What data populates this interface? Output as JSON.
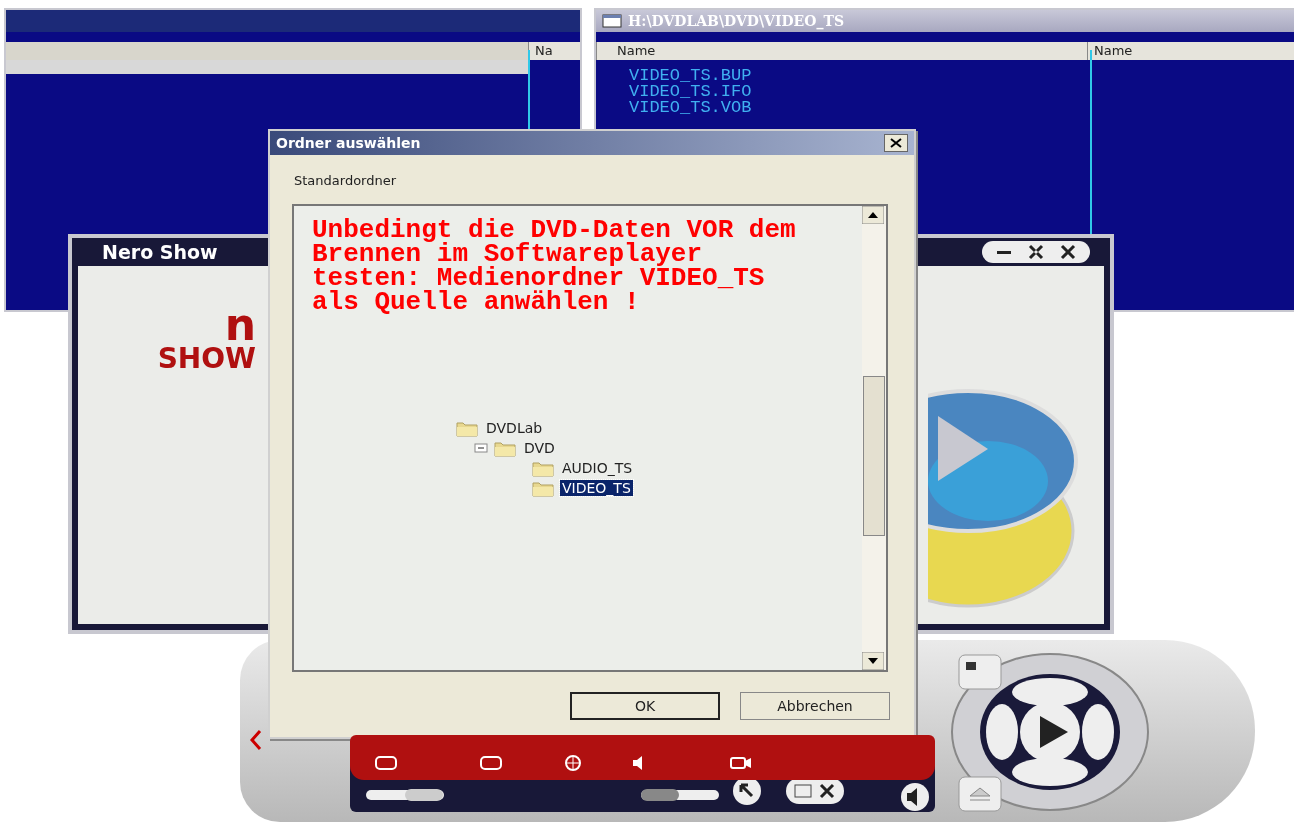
{
  "file_manager_left": {
    "columns": [
      "Na"
    ]
  },
  "file_manager_right": {
    "title": "H:\\DVDLAB\\DVD\\VIDEO_TS",
    "columns": [
      "Name",
      "Name"
    ],
    "files": [
      "VIDEO_TS.BUP",
      "VIDEO_TS.IFO",
      "VIDEO_TS.VOB"
    ]
  },
  "player_window": {
    "title": "Nero Show",
    "logo": [
      "n",
      "SHOW"
    ]
  },
  "dialog": {
    "title": "Ordner auswählen",
    "label": "Standardordner",
    "note": [
      "Unbedingt die DVD-Daten VOR dem",
      "Brennen im Softwareplayer",
      "testen: Medienordner VIDEO_TS",
      "als Quelle anwählen !"
    ],
    "tree": [
      {
        "label": "DVDLab",
        "selected": false,
        "children": [
          {
            "label": "DVD",
            "selected": false,
            "expanded": true,
            "children": [
              {
                "label": "AUDIO_TS",
                "selected": false
              },
              {
                "label": "VIDEO_TS",
                "selected": true
              }
            ]
          }
        ]
      }
    ],
    "buttons": [
      {
        "label": "OK",
        "default": true
      },
      {
        "label": "Abbrechen",
        "default": false
      }
    ]
  }
}
